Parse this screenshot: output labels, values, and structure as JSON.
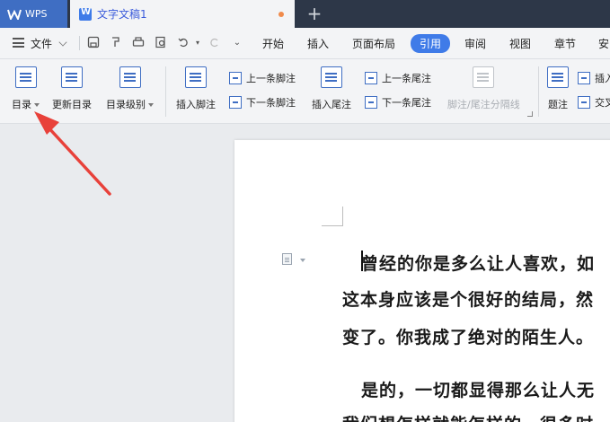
{
  "titlebar": {
    "app_name": "WPS",
    "document_tab": "文字文稿1",
    "new_tab_symbol": "+"
  },
  "menubar": {
    "file_label": "文件",
    "items": [
      "开始",
      "插入",
      "页面布局",
      "引用",
      "审阅",
      "视图",
      "章节",
      "安"
    ],
    "active_item": "引用"
  },
  "ribbon": {
    "toc": "目录",
    "update_toc": "更新目录",
    "toc_level": "目录级别",
    "insert_footnote": "插入脚注",
    "prev_footnote": "上一条脚注",
    "next_footnote": "下一条脚注",
    "insert_endnote": "插入尾注",
    "prev_endnote": "上一条尾注",
    "next_endnote": "下一条尾注",
    "separator_line": "脚注/尾注分隔线",
    "caption": "题注",
    "insert_cross_1": "插入",
    "cross_ref": "交叉"
  },
  "document": {
    "lines": [
      "曾经的你是多么让人喜欢，如",
      "这本身应该是个很好的结局，然",
      "变了。你我成了绝对的陌生人。",
      "是的，一切都显得那么让人无",
      "我们想怎样就能怎样的，很多时"
    ]
  },
  "colors": {
    "accent": "#3f7be8",
    "wps_tab": "#3f6ec3",
    "arrow": "#e8413a"
  }
}
